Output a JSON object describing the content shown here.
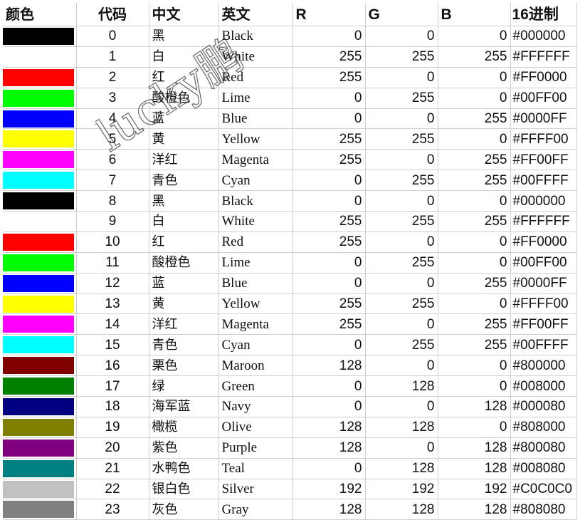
{
  "headers": {
    "swatch": "颜色",
    "code": "代码",
    "cn": "中文",
    "en": "英文",
    "r": "R",
    "g": "G",
    "b": "B",
    "hex": "16进制"
  },
  "watermark": "lucky鹏",
  "rows": [
    {
      "code": "0",
      "cn": "黑",
      "en": "Black",
      "r": "0",
      "g": "0",
      "b": "0",
      "hex": "#000000",
      "color": "#000000"
    },
    {
      "code": "1",
      "cn": "白",
      "en": "White",
      "r": "255",
      "g": "255",
      "b": "255",
      "hex": "#FFFFFF",
      "color": "#FFFFFF"
    },
    {
      "code": "2",
      "cn": "红",
      "en": "Red",
      "r": "255",
      "g": "0",
      "b": "0",
      "hex": "#FF0000",
      "color": "#FF0000"
    },
    {
      "code": "3",
      "cn": "酸橙色",
      "en": "Lime",
      "r": "0",
      "g": "255",
      "b": "0",
      "hex": "#00FF00",
      "color": "#00FF00"
    },
    {
      "code": "4",
      "cn": "蓝",
      "en": "Blue",
      "r": "0",
      "g": "0",
      "b": "255",
      "hex": "#0000FF",
      "color": "#0000FF"
    },
    {
      "code": "5",
      "cn": "黄",
      "en": "Yellow",
      "r": "255",
      "g": "255",
      "b": "0",
      "hex": "#FFFF00",
      "color": "#FFFF00"
    },
    {
      "code": "6",
      "cn": "洋红",
      "en": "Magenta",
      "r": "255",
      "g": "0",
      "b": "255",
      "hex": "#FF00FF",
      "color": "#FF00FF"
    },
    {
      "code": "7",
      "cn": "青色",
      "en": "Cyan",
      "r": "0",
      "g": "255",
      "b": "255",
      "hex": "#00FFFF",
      "color": "#00FFFF"
    },
    {
      "code": "8",
      "cn": "黑",
      "en": "Black",
      "r": "0",
      "g": "0",
      "b": "0",
      "hex": "#000000",
      "color": "#000000"
    },
    {
      "code": "9",
      "cn": "白",
      "en": "White",
      "r": "255",
      "g": "255",
      "b": "255",
      "hex": "#FFFFFF",
      "color": "#FFFFFF"
    },
    {
      "code": "10",
      "cn": "红",
      "en": "Red",
      "r": "255",
      "g": "0",
      "b": "0",
      "hex": "#FF0000",
      "color": "#FF0000"
    },
    {
      "code": "11",
      "cn": "酸橙色",
      "en": "Lime",
      "r": "0",
      "g": "255",
      "b": "0",
      "hex": "#00FF00",
      "color": "#00FF00"
    },
    {
      "code": "12",
      "cn": "蓝",
      "en": "Blue",
      "r": "0",
      "g": "0",
      "b": "255",
      "hex": "#0000FF",
      "color": "#0000FF"
    },
    {
      "code": "13",
      "cn": "黄",
      "en": "Yellow",
      "r": "255",
      "g": "255",
      "b": "0",
      "hex": "#FFFF00",
      "color": "#FFFF00"
    },
    {
      "code": "14",
      "cn": "洋红",
      "en": "Magenta",
      "r": "255",
      "g": "0",
      "b": "255",
      "hex": "#FF00FF",
      "color": "#FF00FF"
    },
    {
      "code": "15",
      "cn": "青色",
      "en": "Cyan",
      "r": "0",
      "g": "255",
      "b": "255",
      "hex": "#00FFFF",
      "color": "#00FFFF"
    },
    {
      "code": "16",
      "cn": "栗色",
      "en": "Maroon",
      "r": "128",
      "g": "0",
      "b": "0",
      "hex": "#800000",
      "color": "#800000"
    },
    {
      "code": "17",
      "cn": "绿",
      "en": "Green",
      "r": "0",
      "g": "128",
      "b": "0",
      "hex": "#008000",
      "color": "#008000"
    },
    {
      "code": "18",
      "cn": "海军蓝",
      "en": "Navy",
      "r": "0",
      "g": "0",
      "b": "128",
      "hex": "#000080",
      "color": "#000080"
    },
    {
      "code": "19",
      "cn": "橄榄",
      "en": "Olive",
      "r": "128",
      "g": "128",
      "b": "0",
      "hex": "#808000",
      "color": "#808000"
    },
    {
      "code": "20",
      "cn": "紫色",
      "en": "Purple",
      "r": "128",
      "g": "0",
      "b": "128",
      "hex": "#800080",
      "color": "#800080"
    },
    {
      "code": "21",
      "cn": "水鸭色",
      "en": "Teal",
      "r": "0",
      "g": "128",
      "b": "128",
      "hex": "#008080",
      "color": "#008080"
    },
    {
      "code": "22",
      "cn": "银白色",
      "en": "Silver",
      "r": "192",
      "g": "192",
      "b": "192",
      "hex": "#C0C0C0",
      "color": "#C0C0C0"
    },
    {
      "code": "23",
      "cn": "灰色",
      "en": "Gray",
      "r": "128",
      "g": "128",
      "b": "128",
      "hex": "#808080",
      "color": "#808080"
    }
  ]
}
